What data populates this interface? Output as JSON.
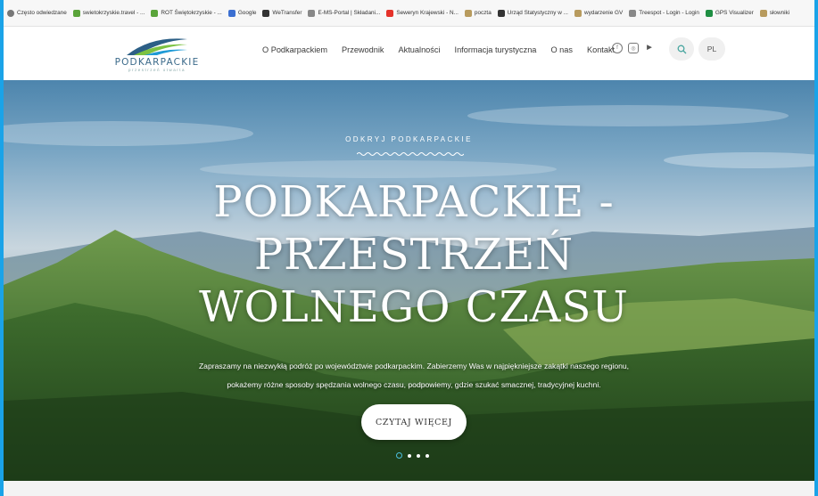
{
  "bookmarks": [
    {
      "label": "Często odwiedzane",
      "icon": "gear-icon"
    },
    {
      "label": "swietokrzyskie.travel - ...",
      "icon": "site-icon"
    },
    {
      "label": "ROT Świętokrzyskie - ...",
      "icon": "site-icon"
    },
    {
      "label": "Google",
      "icon": "google-icon"
    },
    {
      "label": "WeTransfer",
      "icon": "wetransfer-icon"
    },
    {
      "label": "E-MS-Portal | Składani...",
      "icon": "portal-icon"
    },
    {
      "label": "Seweryn Krajewski - N...",
      "icon": "youtube-icon"
    },
    {
      "label": "poczta",
      "icon": "folder-icon"
    },
    {
      "label": "Urząd Statystyczny w ...",
      "icon": "stat-icon"
    },
    {
      "label": "wydarzenie GV",
      "icon": "folder-icon"
    },
    {
      "label": "Treespot - Login - Login",
      "icon": "treespot-icon"
    },
    {
      "label": "GPS Visualizer",
      "icon": "gps-icon"
    },
    {
      "label": "słowniki",
      "icon": "folder-icon"
    }
  ],
  "header": {
    "logo_text": "PODKARPACKIE",
    "logo_sub": "przestrzeń otwarta",
    "nav": [
      "O Podkarpackiem",
      "Przewodnik",
      "Aktualności",
      "Informacja turystyczna",
      "O nas",
      "Kontakt"
    ],
    "social": [
      "facebook-icon",
      "instagram-icon",
      "youtube-icon"
    ],
    "search_icon": "search-icon",
    "lang": "PL"
  },
  "hero": {
    "kicker": "ODKRYJ PODKARPACKIE",
    "title_lines": [
      "PODKARPACKIE -",
      "PRZESTRZEŃ",
      "WOLNEGO CZASU"
    ],
    "lead_lines": [
      "Zapraszamy na niezwykłą podróż po województwie podkarpackim. Zabierzemy Was w najpiękniejsze zakątki naszego regionu,",
      "pokażemy różne sposoby spędzania wolnego czasu, podpowiemy, gdzie szukać smacznej, tradycyjnej kuchni."
    ],
    "cta_label": "CZYTAJ WIĘCEJ",
    "slides_total": 4,
    "slide_active": 1
  },
  "colors": {
    "accent": "#4cc0e0",
    "logo_blue": "#3b6a8a",
    "logo_green": "#7cc242"
  }
}
